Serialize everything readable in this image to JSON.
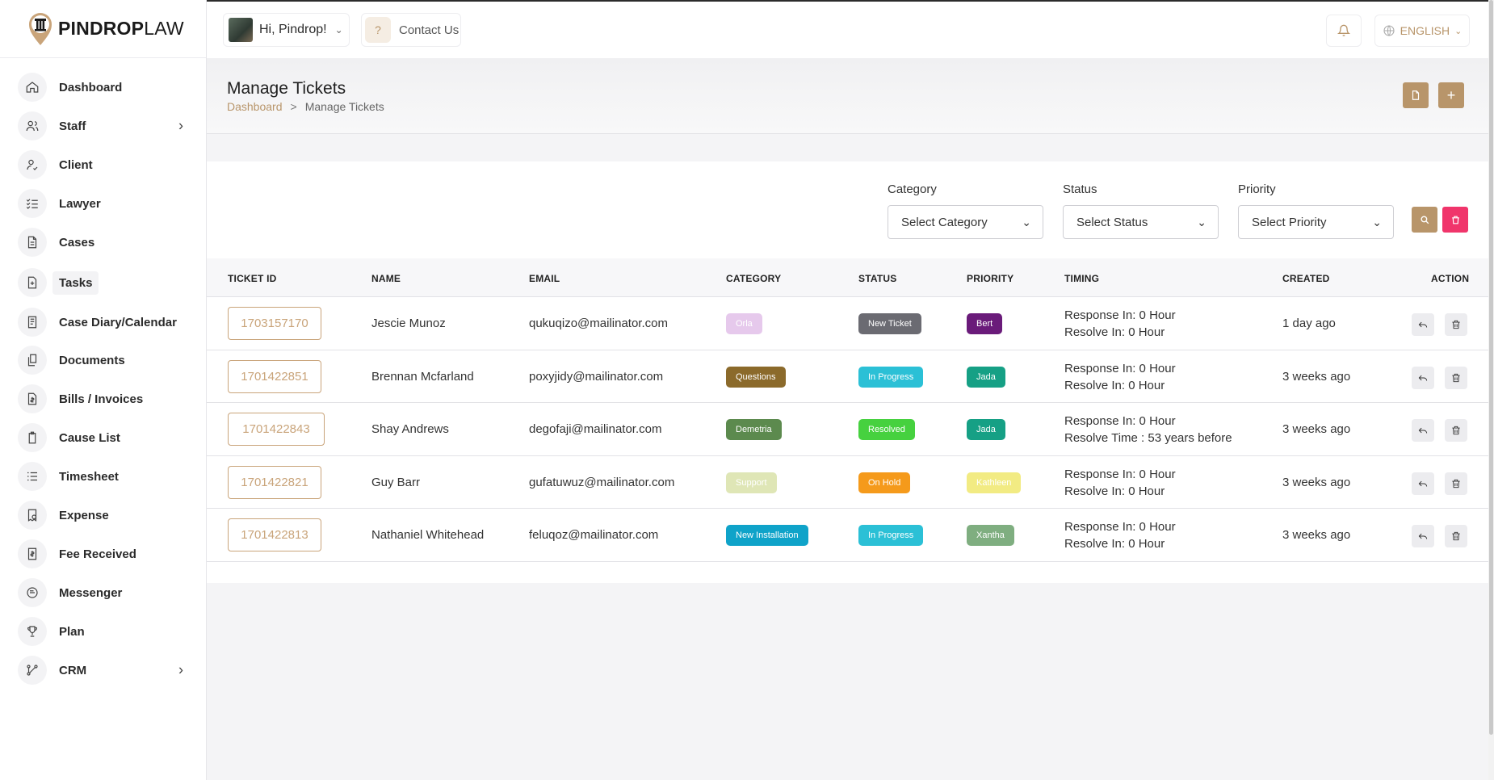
{
  "brand": {
    "bold": "PINDROP",
    "light": "LAW"
  },
  "sidebar": {
    "items": [
      {
        "label": "Dashboard",
        "icon": "home-icon",
        "arrow": false
      },
      {
        "label": "Staff",
        "icon": "users-icon",
        "arrow": true
      },
      {
        "label": "Client",
        "icon": "user-check-icon",
        "arrow": false
      },
      {
        "label": "Lawyer",
        "icon": "list-check-icon",
        "arrow": false
      },
      {
        "label": "Cases",
        "icon": "file-icon",
        "arrow": false
      },
      {
        "label": "Tasks",
        "icon": "file-plus-icon",
        "arrow": false
      },
      {
        "label": "Case Diary/Calendar",
        "icon": "diary-icon",
        "arrow": false
      },
      {
        "label": "Documents",
        "icon": "documents-icon",
        "arrow": false
      },
      {
        "label": "Bills / Invoices",
        "icon": "invoice-icon",
        "arrow": false
      },
      {
        "label": "Cause List",
        "icon": "clipboard-icon",
        "arrow": false
      },
      {
        "label": "Timesheet",
        "icon": "checklist-icon",
        "arrow": false
      },
      {
        "label": "Expense",
        "icon": "receipt-icon",
        "arrow": false
      },
      {
        "label": "Fee Received",
        "icon": "dollar-file-icon",
        "arrow": false
      },
      {
        "label": "Messenger",
        "icon": "chat-icon",
        "arrow": false
      },
      {
        "label": "Plan",
        "icon": "trophy-icon",
        "arrow": false
      },
      {
        "label": "CRM",
        "icon": "crm-icon",
        "arrow": true
      }
    ]
  },
  "topbar": {
    "greeting": "Hi, Pindrop!",
    "contact_label": "Contact Us",
    "language": "ENGLISH"
  },
  "page": {
    "title": "Manage Tickets",
    "breadcrumb_home": "Dashboard",
    "breadcrumb_current": "Manage Tickets"
  },
  "filters": {
    "category_label": "Category",
    "category_value": "Select Category",
    "status_label": "Status",
    "status_value": "Select Status",
    "priority_label": "Priority",
    "priority_value": "Select Priority"
  },
  "table": {
    "headers": [
      "TICKET ID",
      "NAME",
      "EMAIL",
      "CATEGORY",
      "STATUS",
      "PRIORITY",
      "TIMING",
      "CREATED",
      "ACTION"
    ],
    "rows": [
      {
        "id": "1703157170",
        "name": "Jescie Munoz",
        "email": "qukuqizo@mailinator.com",
        "category": "Orla",
        "category_color": "#e6c9ec",
        "category_text": "#ffffff",
        "status": "New Ticket",
        "status_color": "#6b6b72",
        "priority": "Bert",
        "priority_color": "#6a1b7a",
        "priority_text": "#ffffff",
        "timing1": "Response In: 0 Hour",
        "timing2": "Resolve In: 0 Hour",
        "created": "1 day ago"
      },
      {
        "id": "1701422851",
        "name": "Brennan Mcfarland",
        "email": "poxyjidy@mailinator.com",
        "category": "Questions",
        "category_color": "#8b6a2b",
        "category_text": "#ffffff",
        "status": "In Progress",
        "status_color": "#2bc0d6",
        "priority": "Jada",
        "priority_color": "#16a085",
        "priority_text": "#ffffff",
        "timing1": "Response In: 0 Hour",
        "timing2": "Resolve In: 0 Hour",
        "created": "3 weeks ago"
      },
      {
        "id": "1701422843",
        "name": "Shay Andrews",
        "email": "degofaji@mailinator.com",
        "category": "Demetria",
        "category_color": "#5c8a4e",
        "category_text": "#ffffff",
        "status": "Resolved",
        "status_color": "#46d13f",
        "priority": "Jada",
        "priority_color": "#16a085",
        "priority_text": "#ffffff",
        "timing1": "Response In: 0 Hour",
        "timing2": "Resolve Time : 53 years before",
        "created": "3 weeks ago"
      },
      {
        "id": "1701422821",
        "name": "Guy Barr",
        "email": "gufatuwuz@mailinator.com",
        "category": "Support",
        "category_color": "#dfe6b6",
        "category_text": "#ffffff",
        "status": "On Hold",
        "status_color": "#f59a1b",
        "priority": "Kathleen",
        "priority_color": "#f2eb83",
        "priority_text": "#ffffff",
        "timing1": "Response In: 0 Hour",
        "timing2": "Resolve In: 0 Hour",
        "created": "3 weeks ago"
      },
      {
        "id": "1701422813",
        "name": "Nathaniel Whitehead",
        "email": "feluqoz@mailinator.com",
        "category": "New Installation",
        "category_color": "#0fa3c9",
        "category_text": "#ffffff",
        "status": "In Progress",
        "status_color": "#2bc0d6",
        "priority": "Xantha",
        "priority_color": "#7fae80",
        "priority_text": "#ffffff",
        "timing1": "Response In: 0 Hour",
        "timing2": "Resolve In: 0 Hour",
        "created": "3 weeks ago"
      }
    ]
  },
  "colors": {
    "accent": "#b8956a",
    "danger": "#f0356b"
  }
}
